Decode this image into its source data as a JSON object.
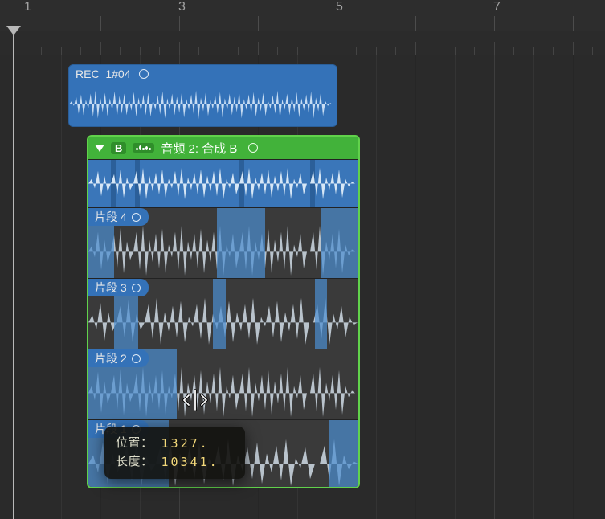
{
  "ruler": {
    "numbers": [
      "1",
      "3",
      "5",
      "7"
    ]
  },
  "clip1": {
    "name": "REC_1#04"
  },
  "folder": {
    "letter": "B",
    "title": "音频 2: 合成 B",
    "lanes": [
      {
        "label": "片段 4"
      },
      {
        "label": "片段 3"
      },
      {
        "label": "片段 2"
      },
      {
        "label": "片段 1"
      }
    ]
  },
  "tooltip": {
    "position_label": "位置：",
    "position_value": "1327.",
    "length_label": "长度：",
    "length_value": "10341."
  }
}
